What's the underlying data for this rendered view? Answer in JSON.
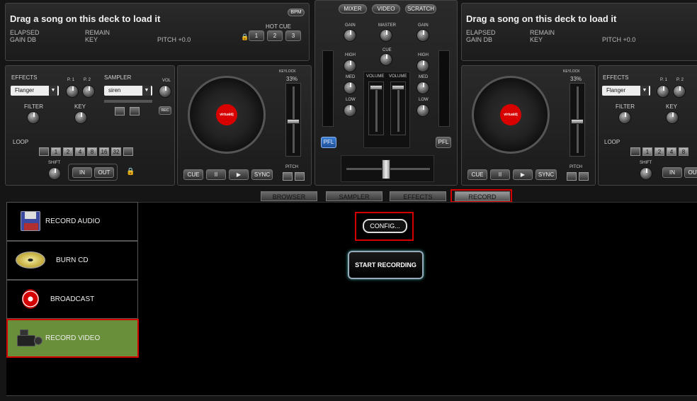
{
  "left_deck": {
    "title": "Drag a song on this deck to load it",
    "elapsed": "ELAPSED",
    "gain": "GAIN dB",
    "remain": "REMAIN",
    "key": "KEY",
    "pitch": "PITCH +0.0",
    "bpm": "BPM",
    "hotcue": "HOT CUE",
    "hotcues": [
      "1",
      "2",
      "3"
    ]
  },
  "right_deck": {
    "title": "Drag a song on this deck to load it",
    "elapsed": "ELAPSED",
    "gain": "GAIN dB",
    "remain": "REMAIN",
    "key": "KEY",
    "pitch": "PITCH +0.0"
  },
  "effects": {
    "label": "EFFECTS",
    "value": "Flanger",
    "p1": "P. 1",
    "p2": "P. 2",
    "filter": "FILTER",
    "key": "KEY",
    "loop": "LOOP",
    "loop_values": [
      "1",
      "2",
      "4",
      "8",
      "16",
      "32"
    ],
    "shift": "SHIFT",
    "in": "IN",
    "out": "OUT"
  },
  "sampler": {
    "label": "SAMPLER",
    "value": "siren",
    "vol": "VOL",
    "rec": "REC"
  },
  "deck_ctrl": {
    "keylock": "KEYLOCK",
    "pitch_pct": "33%",
    "cue": "CUE",
    "pause": "II",
    "play": "▶",
    "sync": "SYNC",
    "pitch": "PITCH",
    "platter_label": "virtualdj"
  },
  "mixer": {
    "tabs": [
      "MIXER",
      "VIDEO",
      "SCRATCH"
    ],
    "gain": "GAIN",
    "master": "MASTER",
    "high": "HIGH",
    "cue": "CUE",
    "med": "MED",
    "low": "LOW",
    "volume": "VOLUME",
    "pfl": "PFL"
  },
  "bottom_tabs": [
    "BROWSER",
    "SAMPLER",
    "EFFECTS",
    "RECORD"
  ],
  "record_menu": [
    "RECORD AUDIO",
    "BURN CD",
    "BROADCAST",
    "RECORD VIDEO"
  ],
  "config_button": "CONFIG...",
  "start_button": "START RECORDING",
  "colors": {
    "selected_item": "#6a8f3a",
    "highlight": "#d40000",
    "platter_label": "#d90000"
  }
}
